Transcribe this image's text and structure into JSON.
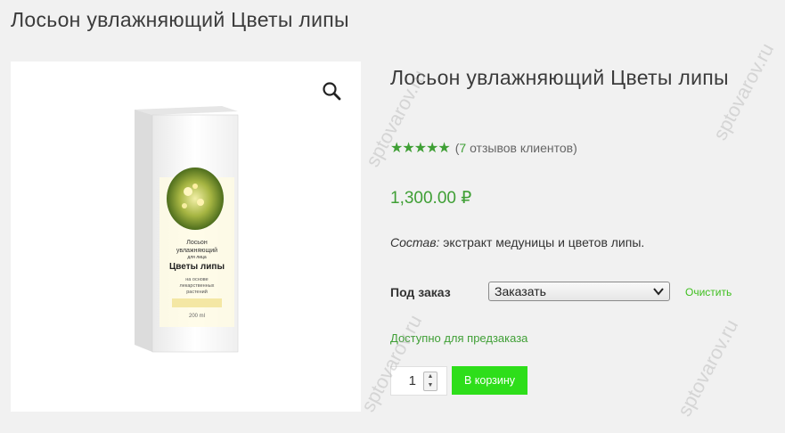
{
  "page": {
    "heading": "Лосьон увлажняющий Цветы липы"
  },
  "gallery": {
    "zoom_icon": "magnifier-icon",
    "box_text": {
      "line1": "Лосьон",
      "line2": "увлажняющий",
      "line3": "для лица",
      "line4": "Цветы липы",
      "line5": "на основе",
      "line6": "лекарственных",
      "line7": "растений",
      "volume": "200 ml"
    }
  },
  "product": {
    "title": "Лосьон увлажняющий Цветы липы",
    "rating": {
      "stars": "★★★★★",
      "open": "(",
      "count": "7",
      "label": " отзывов клиентов)"
    },
    "price": "1,300.00 ₽",
    "description_label": "Состав:",
    "description_text": " экстракт медуницы  и  цветов липы.",
    "variation": {
      "label": "Под заказ",
      "selected": "Заказать",
      "clear": "Очистить"
    },
    "availability": "Доступно для предзаказа",
    "quantity": "1",
    "add_to_cart": "В корзину"
  },
  "watermark": "sptovarov.ru",
  "colors": {
    "accent_green": "#3f9f35",
    "button_green": "#2ede1a",
    "background": "#f1f1f1"
  }
}
